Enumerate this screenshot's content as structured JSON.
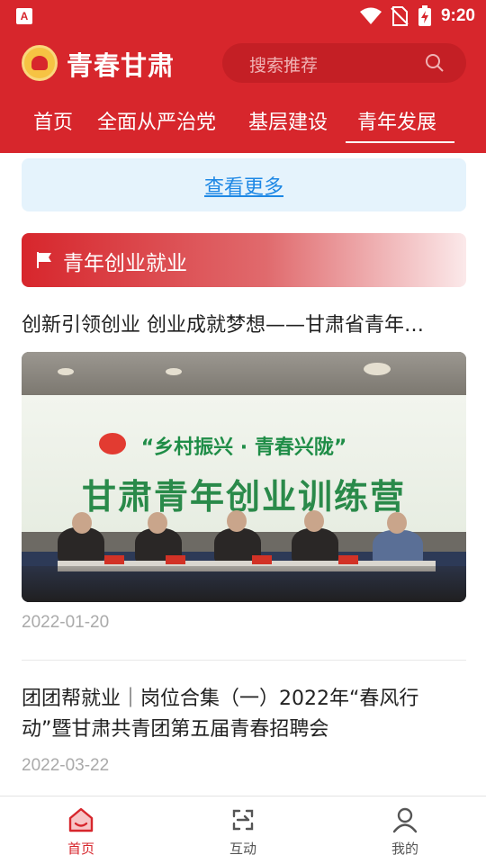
{
  "status_bar": {
    "time": "9:20",
    "left_icon": "A"
  },
  "header": {
    "app_title": "青春甘肃",
    "search_placeholder": "搜索推荐"
  },
  "nav": {
    "tabs": [
      {
        "label": "首页"
      },
      {
        "label": "全面从严治党"
      },
      {
        "label": "基层建设"
      },
      {
        "label": "青年发展"
      }
    ],
    "active_index": 3
  },
  "more_link": "查看更多",
  "section": {
    "title": "青年创业就业"
  },
  "articles": [
    {
      "title": "创新引领创业 创业成就梦想——甘肃省青年…",
      "date": "2022-01-20",
      "image": {
        "banner_line1": "“乡村振兴 · 青春兴陇”",
        "banner_line2": "甘肃青年创业训练营"
      }
    },
    {
      "title": "团团帮就业｜岗位合集（一）2022年“春风行动”暨甘肃共青团第五届青春招聘会",
      "date": "2022-03-22"
    }
  ],
  "bottom_tabs": [
    {
      "label": "首页",
      "icon": "home-icon"
    },
    {
      "label": "互动",
      "icon": "interact-icon"
    },
    {
      "label": "我的",
      "icon": "profile-icon"
    }
  ],
  "colors": {
    "brand": "#d7262c",
    "link": "#1e88e5"
  }
}
